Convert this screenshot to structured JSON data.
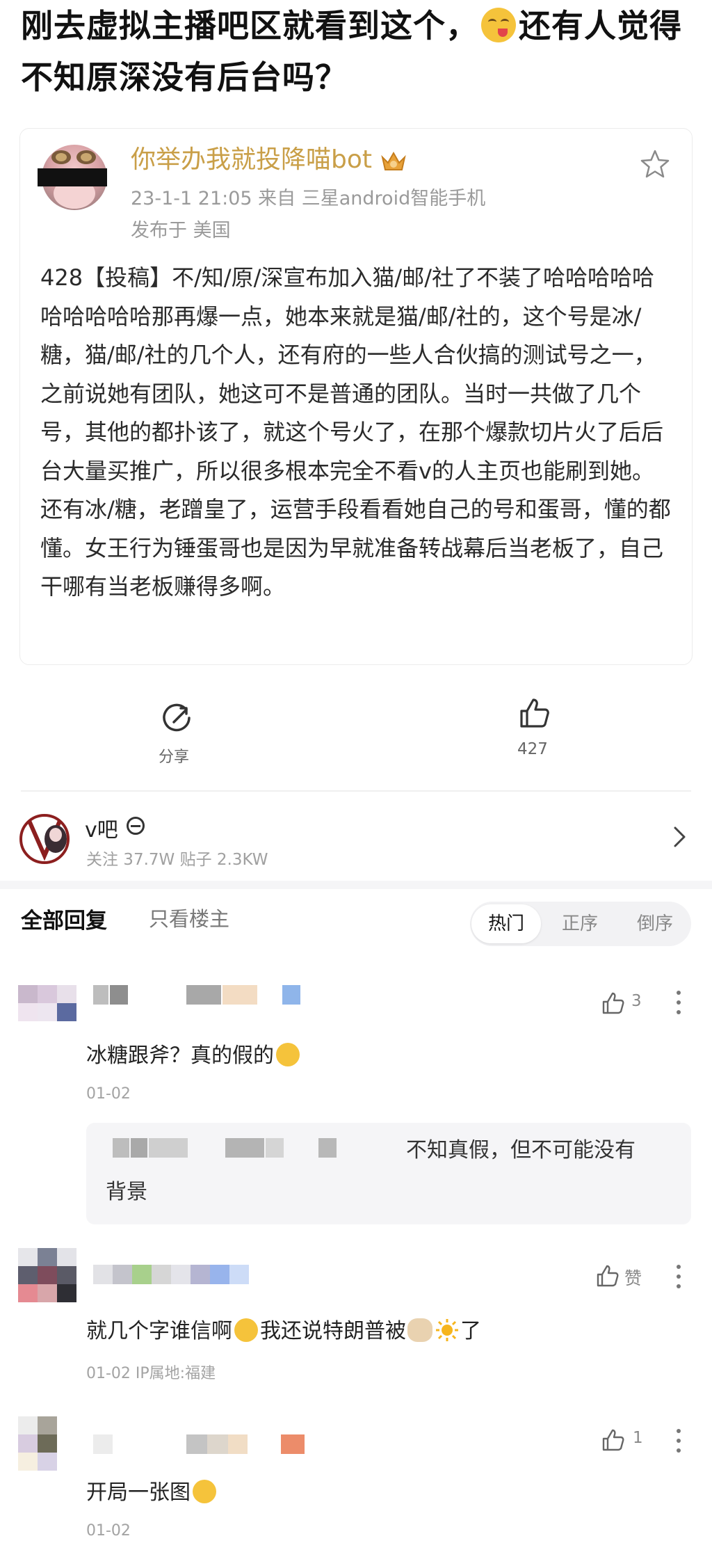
{
  "headline": {
    "part1": "刚去虚拟主播吧区就看到这个，",
    "part2": "还有人觉得不知原深没有后台吗？"
  },
  "post": {
    "author": "你举办我就投降喵bot",
    "time_device": "23-1-1 21:05   来自 三星android智能手机",
    "location": "发布于 美国",
    "body": "428【投稿】不/知/原/深宣布加入猫/邮/社了不装了哈哈哈哈哈哈哈哈哈哈那再爆一点，她本来就是猫/邮/社的，这个号是冰/糖，猫/邮/社的几个人，还有府的一些人合伙搞的测试号之一，之前说她有团队，她这可不是普通的团队。当时一共做了几个号，其他的都扑该了，就这个号火了，在那个爆款切片火了后后台大量买推广，所以很多根本完全不看v的人主页也能刷到她。还有冰/糖，老蹭皇了，运营手段看看她自己的号和蛋哥，懂的都懂。女王行为锤蛋哥也是因为早就准备转战幕后当老板了，自己干哪有当老板赚得多啊。",
    "share_label": "分享",
    "like_count": "427"
  },
  "forum": {
    "name": "v吧",
    "stats": "关注 37.7W   贴子 2.3KW"
  },
  "tabs": {
    "all": "全部回复",
    "owner_only": "只看楼主",
    "sort_hot": "热门",
    "sort_asc": "正序",
    "sort_desc": "倒序"
  },
  "comments": [
    {
      "text": "冰糖跟斧？真的假的",
      "date": "01-02",
      "likes": "3",
      "reply_text_line1": "不知真假，但不可能没有",
      "reply_text_line2": "背景"
    },
    {
      "text_a": "就几个字谁信啊",
      "text_b": "我还说特朗普被",
      "text_c": "了",
      "date": "01-02   IP属地:福建",
      "likes": "赞"
    },
    {
      "text": "开局一张图",
      "date": "01-02",
      "likes": "1"
    }
  ],
  "icons": {
    "star": "star-icon",
    "share": "share-icon",
    "like": "thumbs-up-icon",
    "chevron": "chevron-right-icon",
    "more": "more-vertical-icon"
  },
  "colors": {
    "author_gold": "#c99f48",
    "meta_gray": "#9a9a9a"
  }
}
